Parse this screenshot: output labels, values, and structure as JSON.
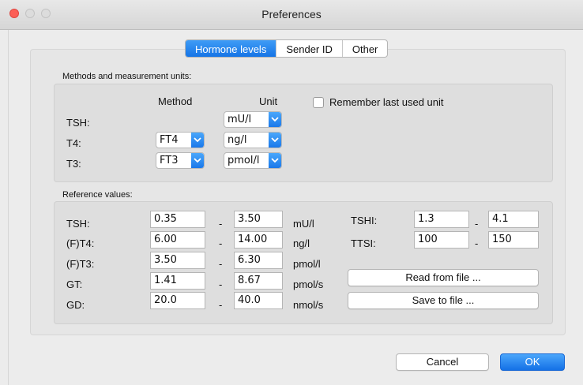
{
  "window": {
    "title": "Preferences"
  },
  "tabs": [
    {
      "label": "Hormone levels",
      "active": true
    },
    {
      "label": "Sender ID",
      "active": false
    },
    {
      "label": "Other",
      "active": false
    }
  ],
  "methods": {
    "section_label": "Methods and measurement units:",
    "method_header": "Method",
    "unit_header": "Unit",
    "remember_label": "Remember last used unit",
    "remember_checked": false,
    "rows": [
      {
        "label": "TSH:",
        "method": "",
        "unit": "mU/l"
      },
      {
        "label": "T4:",
        "method": "FT4",
        "unit": "ng/l"
      },
      {
        "label": "T3:",
        "method": "FT3",
        "unit": "pmol/l"
      }
    ]
  },
  "reference": {
    "section_label": "Reference values:",
    "rows": [
      {
        "label": "TSH:",
        "low": "0.35",
        "dash": "-",
        "high": "3.50",
        "unit": "mU/l"
      },
      {
        "label": "(F)T4:",
        "low": "6.00",
        "dash": "-",
        "high": "14.00",
        "unit": "ng/l"
      },
      {
        "label": "(F)T3:",
        "low": "3.50",
        "dash": "-",
        "high": "6.30",
        "unit": "pmol/l"
      },
      {
        "label": "GT:",
        "low": "1.41",
        "dash": "-",
        "high": "8.67",
        "unit": "pmol/s"
      },
      {
        "label": "GD:",
        "low": "20.0",
        "dash": "-",
        "high": "40.0",
        "unit": "nmol/s"
      }
    ],
    "extra": [
      {
        "label": "TSHI:",
        "low": "1.3",
        "dash": "-",
        "high": "4.1"
      },
      {
        "label": "TTSI:",
        "low": "100",
        "dash": "-",
        "high": "150"
      }
    ],
    "read_button": "Read from file ...",
    "save_button": "Save to file ..."
  },
  "footer": {
    "cancel": "Cancel",
    "ok": "OK"
  },
  "colors": {
    "accent": "#1a78ea",
    "close": "#fc5f57"
  }
}
